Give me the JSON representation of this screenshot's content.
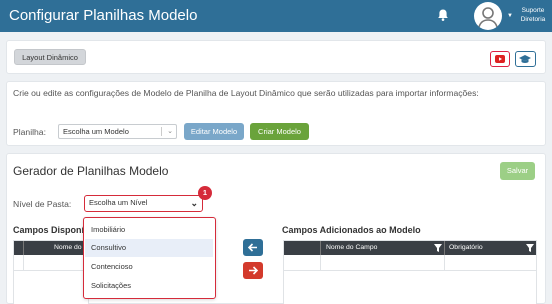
{
  "header": {
    "title": "Configurar Planilhas Modelo",
    "user_line1": "Suporte",
    "user_line2": "Diretoria"
  },
  "toolbar": {
    "layout_label": "Layout Dinâmico"
  },
  "config": {
    "description": "Crie ou edite as configurações de Modelo de Planilha de Layout Dinâmico que serão utilizadas para importar informações:",
    "planilha_label": "Planilha:",
    "planilha_value": "Escolha um Modelo",
    "edit_label": "Editar Modelo",
    "create_label": "Criar Modelo"
  },
  "generator": {
    "title": "Gerador de Planilhas Modelo",
    "save_label": "Salvar",
    "nivel_label": "Nível de Pasta:",
    "nivel_value": "Escolha um Nível",
    "badge": "1",
    "available_title": "Campos Disponíveis",
    "available_col": "Nome do Campo",
    "added_title": "Campos Adicionados ao Modelo",
    "added_col1": "Nome do Campo",
    "added_col2": "Obrigatório"
  },
  "dropdown": {
    "options": [
      "Imobiliário",
      "Consultivo",
      "Contencioso",
      "Solicitações"
    ],
    "highlighted": "Consultivo"
  },
  "colors": {
    "header": "#2f6f97",
    "accent_red": "#d52b3a",
    "green": "#6aa33b"
  }
}
